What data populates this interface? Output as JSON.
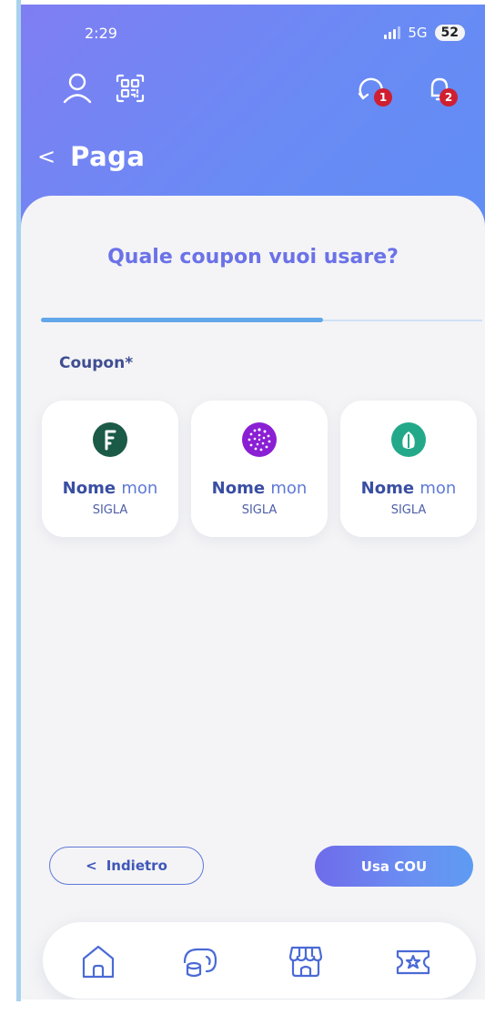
{
  "status_bar": {
    "time": "2:29",
    "network": "5G",
    "battery": "52"
  },
  "header": {
    "badges": {
      "history": "1",
      "notifications": "2"
    },
    "back_label": "<",
    "title": "Paga"
  },
  "main": {
    "question": "Quale coupon vuoi usare?",
    "progress": 0.64,
    "section_label": "Coupon*",
    "coupons": [
      {
        "name_part1": "Nome",
        "name_part2": "mon",
        "sigla": "SIGLA",
        "icon": "feather-coin-icon",
        "color": "#1b5a46"
      },
      {
        "name_part1": "Nome",
        "name_part2": "mon",
        "sigla": "SIGLA",
        "icon": "iota-coin-icon",
        "color": "#8a1fd4"
      },
      {
        "name_part1": "Nome",
        "name_part2": "mon",
        "sigla": "SIGLA",
        "icon": "leaf-coin-icon",
        "color": "#23a98a"
      }
    ]
  },
  "actions": {
    "back_icon": "<",
    "back_label": "Indietro",
    "next_label": "Usa COU"
  },
  "tabbar": {
    "items": [
      {
        "icon": "home-icon"
      },
      {
        "icon": "wallet-icon"
      },
      {
        "icon": "shop-icon"
      },
      {
        "icon": "coupon-icon"
      }
    ]
  },
  "colors": {
    "accent": "#6b72e8",
    "primary": "#3f57b8",
    "badge": "#cf1f31"
  }
}
